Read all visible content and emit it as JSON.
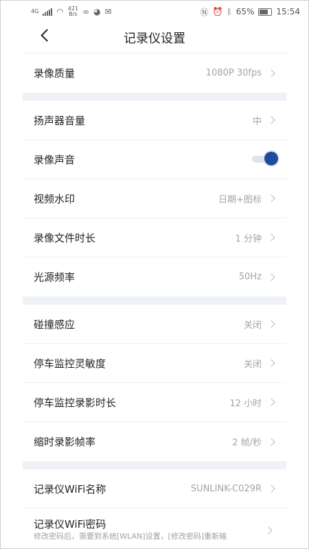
{
  "status_bar": {
    "network": "4G",
    "speed_value": "421",
    "speed_unit": "B/s",
    "battery": "65%",
    "time": "15:54"
  },
  "header": {
    "title": "记录仪设置"
  },
  "groups": [
    [
      {
        "label": "录像质量",
        "value": "1080P 30fps"
      }
    ],
    [
      {
        "label": "扬声器音量",
        "value": "中"
      },
      {
        "label": "录像声音",
        "toggle": "on"
      },
      {
        "label": "视频水印",
        "value": "日期+图标"
      },
      {
        "label": "录像文件时长",
        "value": "1 分钟"
      },
      {
        "label": "光源频率",
        "value": "50Hz"
      }
    ],
    [
      {
        "label": "碰撞感应",
        "value": "关闭"
      },
      {
        "label": "停车监控灵敏度",
        "value": "关闭"
      },
      {
        "label": "停车监控录影时长",
        "value": "12 小时"
      },
      {
        "label": "缩时录影帧率",
        "value": "2 帧/秒"
      }
    ],
    [
      {
        "label": "记录仪WiFi名称",
        "value": "SUNLINK-C029R"
      },
      {
        "label": "记录仪WiFi密码",
        "subtext": "修改密码后，需要到系统[WLAN]设置，[修改密码]重新输"
      }
    ]
  ],
  "colors": {
    "accent": "#1f4a9e",
    "section_gap": "#eef1f6"
  }
}
